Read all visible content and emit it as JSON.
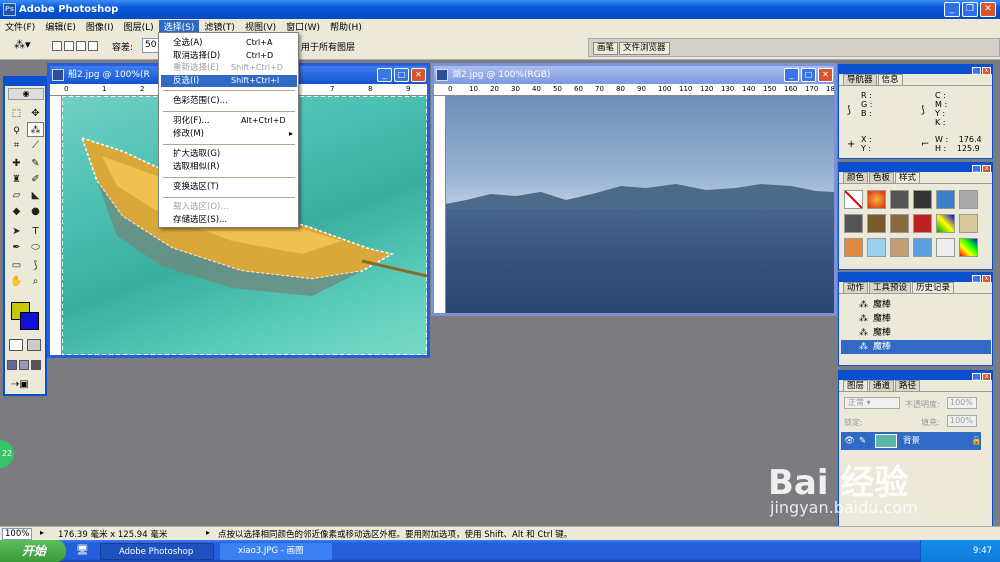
{
  "app": {
    "title": "Adobe Photoshop"
  },
  "menu": [
    "文件(F)",
    "编辑(E)",
    "图像(I)",
    "图层(L)",
    "选择(S)",
    "滤镜(T)",
    "视图(V)",
    "窗口(W)",
    "帮助(H)"
  ],
  "options": {
    "tolerance_label": "容差:",
    "tolerance_value": "50",
    "all_layers_label": "用于所有图层"
  },
  "palette_well": {
    "tabs": [
      "画笔",
      "文件浏览器"
    ]
  },
  "select_menu": {
    "items": [
      {
        "label": "全选(A)",
        "shortcut": "Ctrl+A",
        "disabled": false
      },
      {
        "label": "取消选择(D)",
        "shortcut": "Ctrl+D",
        "disabled": false
      },
      {
        "label": "重新选择(E)",
        "shortcut": "Shift+Ctrl+D",
        "disabled": true
      },
      {
        "label": "反选(I)",
        "shortcut": "Shift+Ctrl+I",
        "disabled": false,
        "highlighted": true
      },
      {
        "label": "色彩范围(C)...",
        "shortcut": "",
        "disabled": false
      },
      {
        "label": "羽化(F)...",
        "shortcut": "Alt+Ctrl+D",
        "disabled": false
      },
      {
        "label": "修改(M)",
        "shortcut": "",
        "disabled": false
      },
      {
        "label": "扩大选取(G)",
        "shortcut": "",
        "disabled": false
      },
      {
        "label": "选取相似(R)",
        "shortcut": "",
        "disabled": false
      },
      {
        "label": "变换选区(T)",
        "shortcut": "",
        "disabled": false
      },
      {
        "label": "载入选区(O)...",
        "shortcut": "",
        "disabled": true
      },
      {
        "label": "存储选区(S)...",
        "shortcut": "",
        "disabled": false
      }
    ]
  },
  "doc1": {
    "title": "船2.jpg @ 100%(R",
    "ruler": [
      "0",
      "1",
      "2",
      "3",
      "4",
      "5",
      "6",
      "7",
      "8",
      "9"
    ]
  },
  "doc2": {
    "title": "湖2.jpg @ 100%(RGB)",
    "ruler": [
      "0",
      "10",
      "20",
      "30",
      "40",
      "50",
      "60",
      "70",
      "80",
      "90",
      "100",
      "110",
      "120",
      "130",
      "140",
      "150",
      "160",
      "170",
      "180"
    ]
  },
  "navigator": {
    "tabs": [
      "导航器",
      "信息"
    ],
    "rgb_labels": [
      "R :",
      "G :",
      "B :"
    ],
    "cmyk_labels": [
      "C :",
      "M :",
      "Y :",
      "K :"
    ],
    "x_label": "X :",
    "y_label": "Y :",
    "w_label": "W :",
    "h_label": "H :",
    "w_value": "176.4",
    "h_value": "125.9"
  },
  "color": {
    "tabs": [
      "颜色",
      "色板",
      "样式"
    ]
  },
  "history": {
    "tabs": [
      "动作",
      "工具预设",
      "历史记录"
    ],
    "items": [
      "魔棒",
      "魔棒",
      "魔棒",
      "魔棒"
    ]
  },
  "layers": {
    "tabs": [
      "图层",
      "通道",
      "路径"
    ],
    "mode": "正常",
    "opacity_label": "不透明度:",
    "opacity_value": "100%",
    "lock_label": "锁定:",
    "fill_label": "填充:",
    "fill_value": "100%",
    "layer_name": "背景"
  },
  "status": {
    "zoom": "100%",
    "size": "176.39 毫米 x 125.94 毫米",
    "hint": "点按以选择相同颜色的邻近像素或移动选区外框。要用附加选项，使用 Shift、Alt 和 Ctrl 键。"
  },
  "taskbar": {
    "start": "开始",
    "tasks": [
      "Adobe Photoshop",
      "xiao3.JPG - 画图"
    ],
    "time": "9:47"
  },
  "watermark": {
    "logo": "Bai 经验",
    "url": "jingyan.baidu.com"
  },
  "badge": "22"
}
